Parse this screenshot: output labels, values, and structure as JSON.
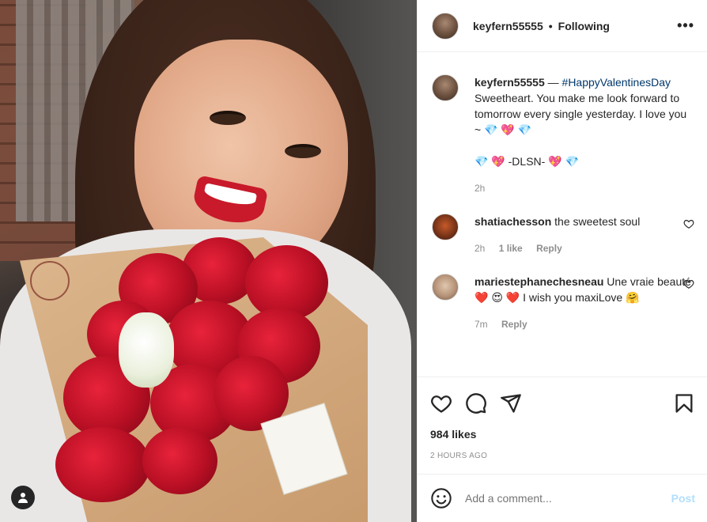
{
  "post": {
    "username": "keyfern55555",
    "follow_status": "Following",
    "more_label": "•••",
    "caption": {
      "username": "keyfern55555",
      "separator": " — ",
      "hashtag": "#HappyValentinesDay",
      "text": "Sweetheart. You make me look forward to tomorrow every single yesterday. I love you ~ 💎 💖 💎\n\n💎 💖 -DLSN- 💖 💎",
      "time": "2h"
    },
    "comments": [
      {
        "username": "shatiachesson",
        "text": "the sweetest soul",
        "time": "2h",
        "likes": "1 like",
        "reply": "Reply"
      },
      {
        "username": "mariestephanechesneau",
        "text": "Une vraie beauté ❤️ 😍 ❤️  I wish you maxiLove 🤗",
        "time": "7m",
        "reply": "Reply"
      }
    ],
    "likes_count": "984 likes",
    "posted_ago": "2 HOURS AGO",
    "add_comment_placeholder": "Add a comment...",
    "post_button": "Post"
  },
  "icons": [
    "user-icon",
    "more-icon",
    "heart-icon",
    "comment-icon",
    "share-icon",
    "bookmark-icon",
    "emoji-icon"
  ],
  "colors": {
    "link": "#00376b",
    "muted": "#8e8e8e",
    "post_disabled": "#b2dffc"
  }
}
